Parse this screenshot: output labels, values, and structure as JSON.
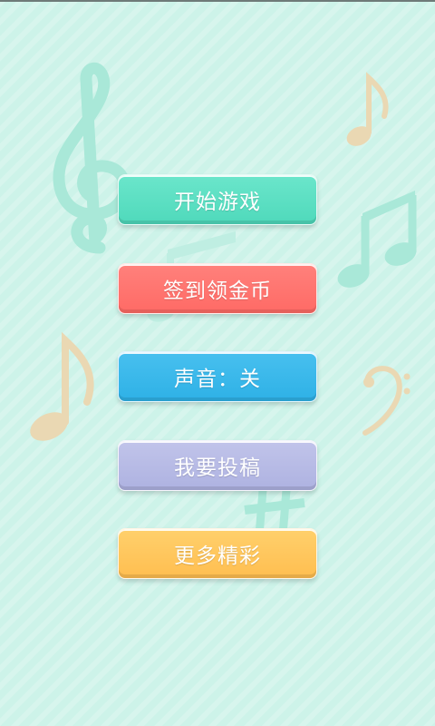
{
  "menu": {
    "buttons": [
      {
        "label": "开始游戏",
        "color": "#52ddbf"
      },
      {
        "label": "签到领金币",
        "color": "#ff6f6a"
      },
      {
        "label": "声音：关",
        "color": "#35b6ea"
      },
      {
        "label": "我要投稿",
        "color": "#b4b8e4"
      },
      {
        "label": "更多精彩",
        "color": "#ffc559"
      }
    ]
  },
  "colors": {
    "background": "#cdf3e9",
    "note_mint": "#a7e6d6",
    "note_beige": "#e8d9b6"
  },
  "decorations": [
    "treble-clef-icon",
    "eighth-note-icon",
    "beamed-note-icon",
    "bass-clef-icon",
    "sharp-icon"
  ]
}
